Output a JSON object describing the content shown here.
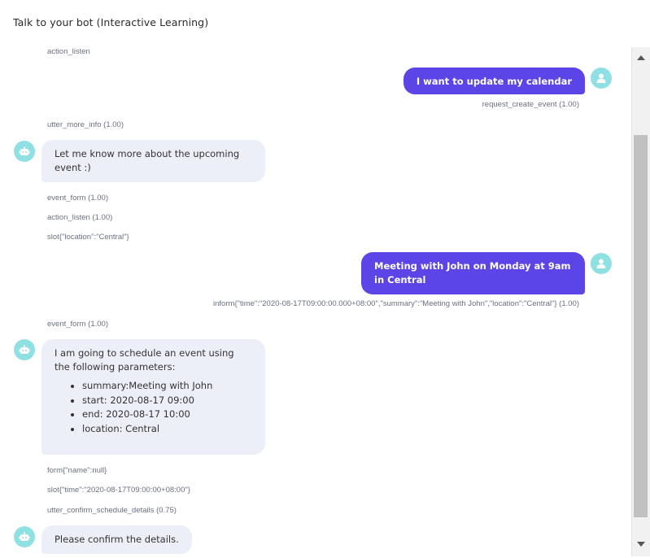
{
  "header": {
    "title": "Talk to your bot (Interactive Learning)"
  },
  "conversation": {
    "meta_action_listen_top": "action_listen",
    "user_msg_1": "I want to update my calendar",
    "intent_1": "request_create_event (1.00)",
    "action_utter_more_info": "utter_more_info (1.00)",
    "bot_msg_1": "Let me know more about the upcoming event :)",
    "action_event_form": "event_form (1.00)",
    "action_listen_2": "action_listen (1.00)",
    "slot_location": "slot{\"location\":\"Central\"}",
    "user_msg_2": "Meeting with John on Monday at 9am in Central",
    "intent_2": "inform{\"time\":\"2020-08-17T09:00:00.000+08:00\",\"summary\":\"Meeting with John\",\"location\":\"Central\"} (1.00)",
    "action_event_form_2": "event_form (1.00)",
    "bot_msg_2": {
      "intro": "I am going to schedule an event using the following parameters:",
      "items": [
        "summary:Meeting with John",
        "start: 2020-08-17 09:00",
        "end: 2020-08-17 10:00",
        "location: Central"
      ]
    },
    "form_null": "form{\"name\":null}",
    "slot_time": "slot{\"time\":\"2020-08-17T09:00:00+08:00\"}",
    "action_confirm": "utter_confirm_schedule_details (0.75)",
    "bot_msg_3": "Please confirm the details."
  },
  "colors": {
    "user_bubble": "#5b45e6",
    "bot_bubble": "#eceff7",
    "avatar": "#8fe0e2"
  },
  "icons": {
    "user_avatar": "user-icon",
    "bot_avatar": "robot-icon"
  }
}
